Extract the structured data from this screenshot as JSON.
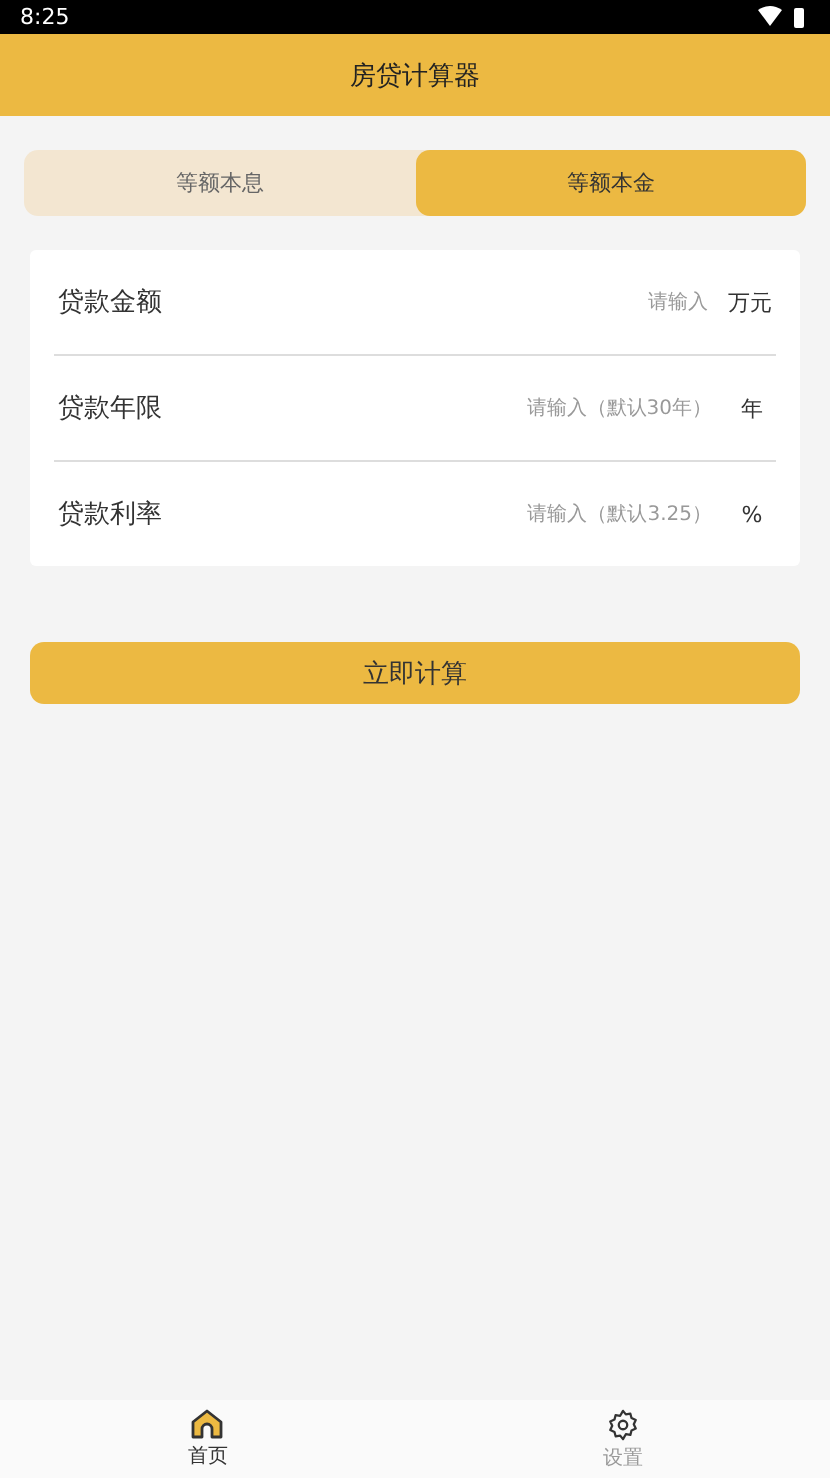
{
  "status_bar": {
    "time": "8:25"
  },
  "header": {
    "title": "房贷计算器"
  },
  "tabs": [
    {
      "label": "等额本息",
      "selected": false
    },
    {
      "label": "等额本金",
      "selected": true
    }
  ],
  "fields": [
    {
      "label": "贷款金额",
      "placeholder": "请输入",
      "unit": "万元"
    },
    {
      "label": "贷款年限",
      "placeholder": "请输入（默认30年）",
      "unit": "年"
    },
    {
      "label": "贷款利率",
      "placeholder": "请输入（默认3.25）",
      "unit": "%"
    }
  ],
  "calculate_button": "立即计算",
  "bottom_nav": [
    {
      "kind": "home",
      "label": "首页",
      "selected": true
    },
    {
      "kind": "settings",
      "label": "设置",
      "selected": false
    }
  ]
}
